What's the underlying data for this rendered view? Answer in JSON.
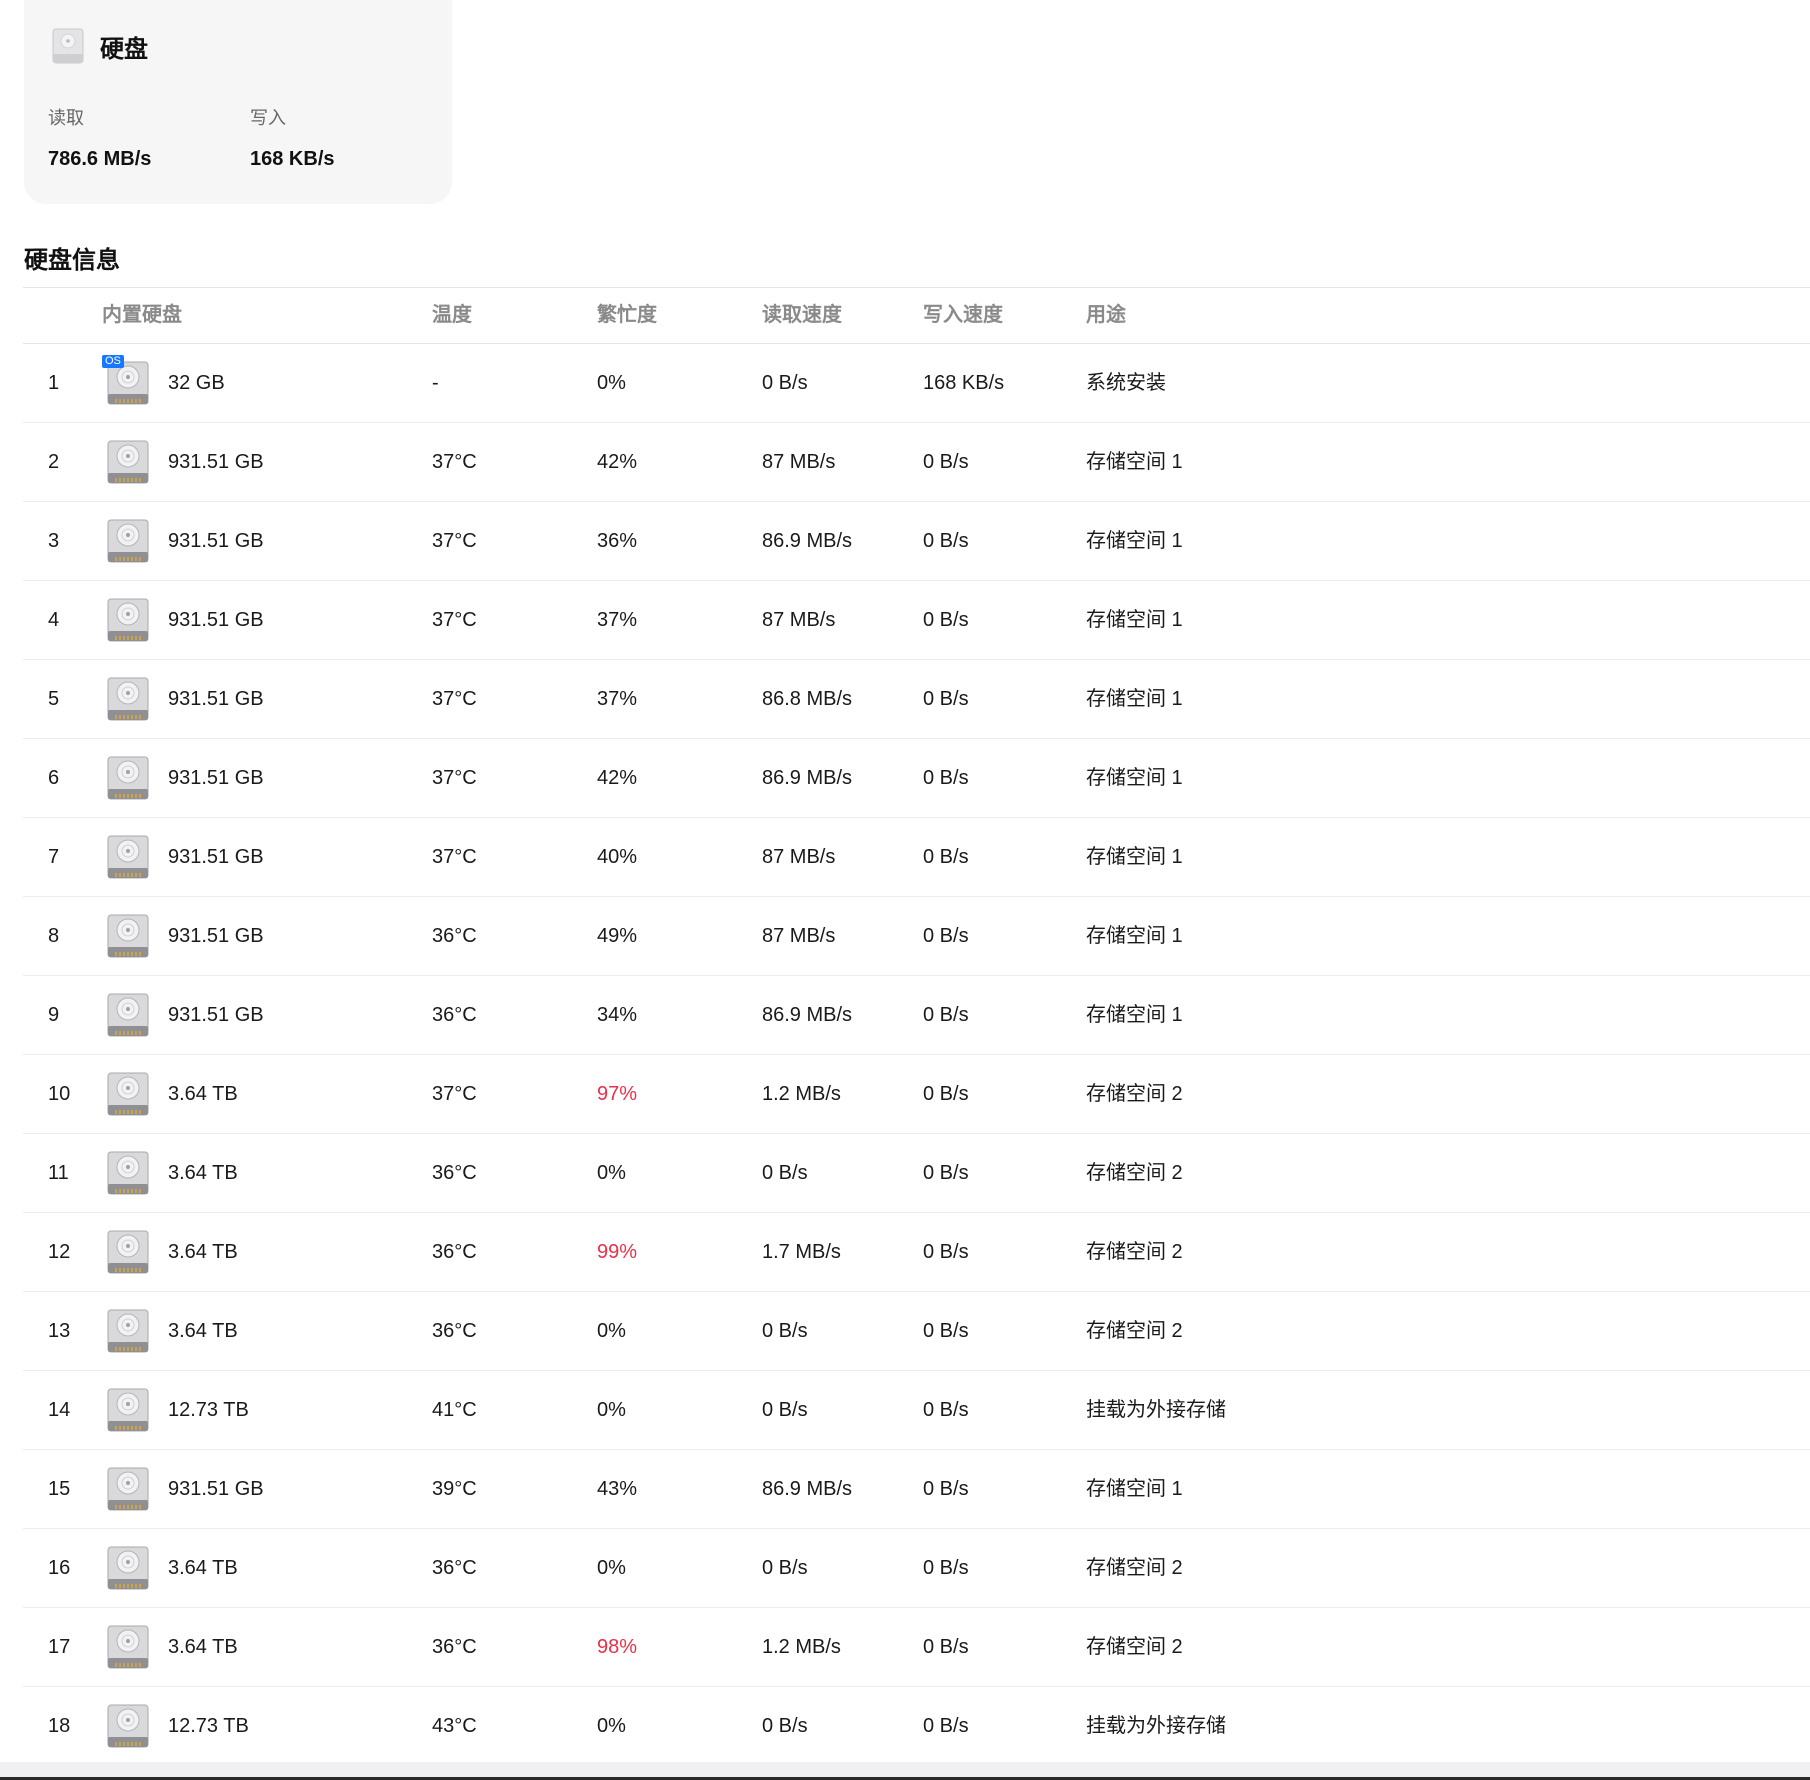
{
  "card": {
    "title": "硬盘",
    "icon": "hard-disk-icon",
    "read_label": "读取",
    "read_value": "786.6 MB/s",
    "write_label": "写入",
    "write_value": "168 KB/s"
  },
  "section": {
    "title": "硬盘信息"
  },
  "table": {
    "headers": {
      "drive": "内置硬盘",
      "temp": "温度",
      "busy": "繁忙度",
      "read": "读取速度",
      "write": "写入速度",
      "usage": "用途"
    },
    "os_badge": "OS",
    "high_color": "#e8304a",
    "rows": [
      {
        "idx": "1",
        "size": "32 GB",
        "temp": "-",
        "busy": "0%",
        "read": "0 B/s",
        "write": "168 KB/s",
        "usage": "系统安装",
        "os": true,
        "high": false
      },
      {
        "idx": "2",
        "size": "931.51 GB",
        "temp": "37°C",
        "busy": "42%",
        "read": "87 MB/s",
        "write": "0 B/s",
        "usage": "存储空间 1",
        "high": false
      },
      {
        "idx": "3",
        "size": "931.51 GB",
        "temp": "37°C",
        "busy": "36%",
        "read": "86.9 MB/s",
        "write": "0 B/s",
        "usage": "存储空间 1",
        "high": false
      },
      {
        "idx": "4",
        "size": "931.51 GB",
        "temp": "37°C",
        "busy": "37%",
        "read": "87 MB/s",
        "write": "0 B/s",
        "usage": "存储空间 1",
        "high": false
      },
      {
        "idx": "5",
        "size": "931.51 GB",
        "temp": "37°C",
        "busy": "37%",
        "read": "86.8 MB/s",
        "write": "0 B/s",
        "usage": "存储空间 1",
        "high": false
      },
      {
        "idx": "6",
        "size": "931.51 GB",
        "temp": "37°C",
        "busy": "42%",
        "read": "86.9 MB/s",
        "write": "0 B/s",
        "usage": "存储空间 1",
        "high": false
      },
      {
        "idx": "7",
        "size": "931.51 GB",
        "temp": "37°C",
        "busy": "40%",
        "read": "87 MB/s",
        "write": "0 B/s",
        "usage": "存储空间 1",
        "high": false
      },
      {
        "idx": "8",
        "size": "931.51 GB",
        "temp": "36°C",
        "busy": "49%",
        "read": "87 MB/s",
        "write": "0 B/s",
        "usage": "存储空间 1",
        "high": false
      },
      {
        "idx": "9",
        "size": "931.51 GB",
        "temp": "36°C",
        "busy": "34%",
        "read": "86.9 MB/s",
        "write": "0 B/s",
        "usage": "存储空间 1",
        "high": false
      },
      {
        "idx": "10",
        "size": "3.64 TB",
        "temp": "37°C",
        "busy": "97%",
        "read": "1.2 MB/s",
        "write": "0 B/s",
        "usage": "存储空间 2",
        "high": true
      },
      {
        "idx": "11",
        "size": "3.64 TB",
        "temp": "36°C",
        "busy": "0%",
        "read": "0 B/s",
        "write": "0 B/s",
        "usage": "存储空间 2",
        "high": false
      },
      {
        "idx": "12",
        "size": "3.64 TB",
        "temp": "36°C",
        "busy": "99%",
        "read": "1.7 MB/s",
        "write": "0 B/s",
        "usage": "存储空间 2",
        "high": true
      },
      {
        "idx": "13",
        "size": "3.64 TB",
        "temp": "36°C",
        "busy": "0%",
        "read": "0 B/s",
        "write": "0 B/s",
        "usage": "存储空间 2",
        "high": false
      },
      {
        "idx": "14",
        "size": "12.73 TB",
        "temp": "41°C",
        "busy": "0%",
        "read": "0 B/s",
        "write": "0 B/s",
        "usage": "挂载为外接存储",
        "high": false
      },
      {
        "idx": "15",
        "size": "931.51 GB",
        "temp": "39°C",
        "busy": "43%",
        "read": "86.9 MB/s",
        "write": "0 B/s",
        "usage": "存储空间 1",
        "high": false
      },
      {
        "idx": "16",
        "size": "3.64 TB",
        "temp": "36°C",
        "busy": "0%",
        "read": "0 B/s",
        "write": "0 B/s",
        "usage": "存储空间 2",
        "high": false
      },
      {
        "idx": "17",
        "size": "3.64 TB",
        "temp": "36°C",
        "busy": "98%",
        "read": "1.2 MB/s",
        "write": "0 B/s",
        "usage": "存储空间 2",
        "high": true
      },
      {
        "idx": "18",
        "size": "12.73 TB",
        "temp": "43°C",
        "busy": "0%",
        "read": "0 B/s",
        "write": "0 B/s",
        "usage": "挂载为外接存储",
        "high": false
      }
    ]
  }
}
